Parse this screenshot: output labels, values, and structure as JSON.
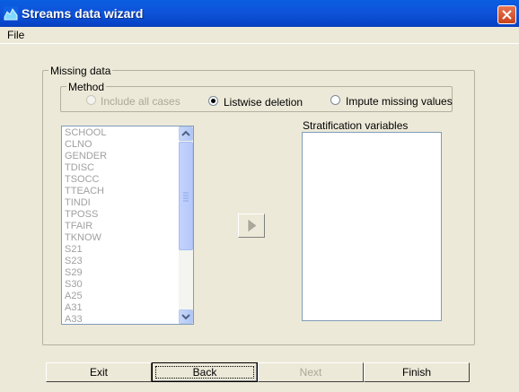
{
  "window": {
    "title": "Streams data wizard"
  },
  "menu": {
    "items": [
      "File"
    ]
  },
  "missing_data": {
    "group_label": "Missing data",
    "method": {
      "label": "Method",
      "options": [
        {
          "label": "Include all cases",
          "selected": false,
          "enabled": false
        },
        {
          "label": "Listwise deletion",
          "selected": true,
          "enabled": true
        },
        {
          "label": "Impute missing values",
          "selected": false,
          "enabled": true
        }
      ]
    },
    "variables": [
      "SCHOOL",
      "CLNO",
      "GENDER",
      "TDISC",
      "TSOCC",
      "TTEACH",
      "TINDI",
      "TPOSS",
      "TFAIR",
      "TKNOW",
      "S21",
      "S23",
      "S29",
      "S30",
      "A25",
      "A31",
      "A33"
    ],
    "stratification_label": "Stratification variables",
    "stratification_variables": []
  },
  "buttons": {
    "exit": "Exit",
    "back": "Back",
    "next": "Next",
    "finish": "Finish"
  },
  "colors": {
    "titlebar": "#0a5fe0",
    "dialog": "#ece9d8",
    "close": "#d5532c"
  }
}
